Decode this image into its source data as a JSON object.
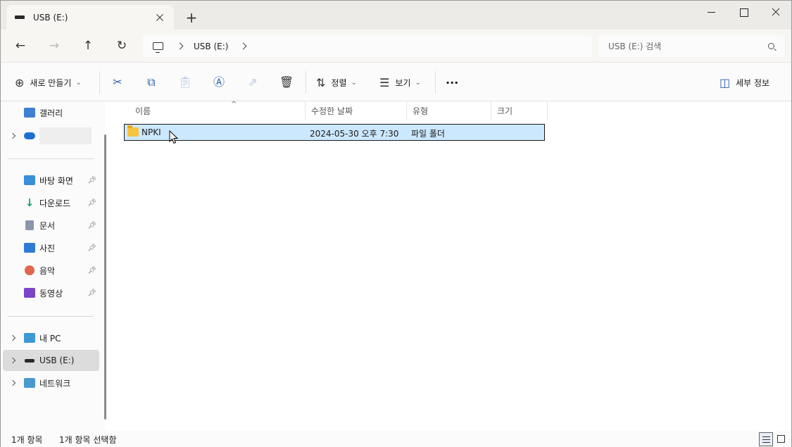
{
  "tab": {
    "title": "USB (E:)",
    "new_tab": "+"
  },
  "address": {
    "crumbs": [
      "USB (E:)"
    ]
  },
  "search": {
    "placeholder": "USB (E:) 검색"
  },
  "toolbar": {
    "new_label": "새로 만들기",
    "sort_label": "정렬",
    "view_label": "보기",
    "more_label": "···",
    "details_label": "세부 정보"
  },
  "sidebar": {
    "gallery": "갤러리",
    "onedrive": "",
    "quick": [
      {
        "label": "바탕 화면"
      },
      {
        "label": "다운로드"
      },
      {
        "label": "문서"
      },
      {
        "label": "사진"
      },
      {
        "label": "음악"
      },
      {
        "label": "동영상"
      }
    ],
    "thispc": "내 PC",
    "usb": "USB (E:)",
    "network": "네트워크"
  },
  "columns": {
    "name": "이름",
    "modified": "수정한 날짜",
    "type": "유형",
    "size": "크기"
  },
  "files": [
    {
      "name": "NPKI",
      "modified": "2024-05-30 오후 7:30",
      "type": "파일 폴더",
      "size": ""
    }
  ],
  "status": {
    "count": "1개 항목",
    "selected": "1개 항목 선택함"
  },
  "colors": {
    "accent": "#2a5fb0",
    "selection": "#cce8ff",
    "folder": "#f6c440"
  },
  "icons": [
    "drive-icon",
    "back-icon",
    "forward-icon",
    "up-icon",
    "refresh-icon",
    "monitor-icon",
    "search-icon",
    "cut-icon",
    "copy-icon",
    "paste-icon",
    "rename-icon",
    "share-icon",
    "delete-icon",
    "folder-icon",
    "pin-icon"
  ]
}
